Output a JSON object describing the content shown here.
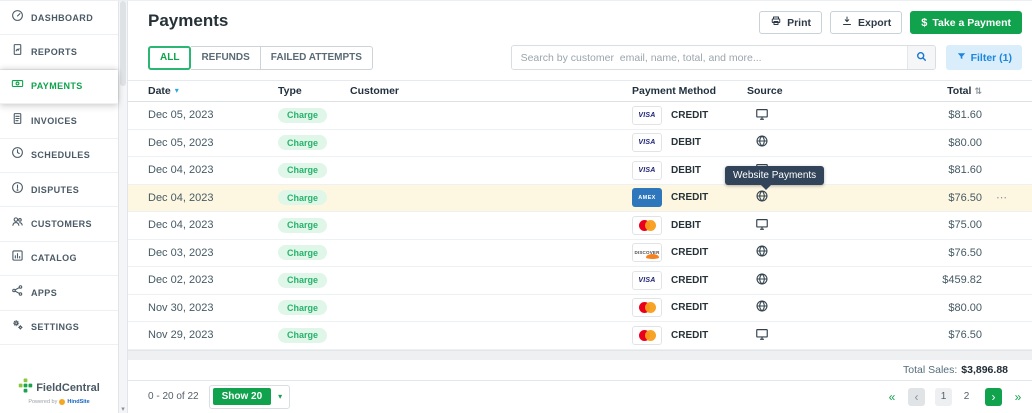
{
  "sidebar": {
    "items": [
      {
        "label": "DASHBOARD",
        "icon": "gauge-icon",
        "svg": "gauge",
        "active": false
      },
      {
        "label": "REPORTS",
        "icon": "report-icon",
        "svg": "report",
        "active": false
      },
      {
        "label": "PAYMENTS",
        "icon": "payments-icon",
        "svg": "payments",
        "active": true
      },
      {
        "label": "INVOICES",
        "icon": "invoice-icon",
        "svg": "invoice",
        "active": false
      },
      {
        "label": "SCHEDULES",
        "icon": "clock-icon",
        "svg": "clock",
        "active": false
      },
      {
        "label": "DISPUTES",
        "icon": "dispute-icon",
        "svg": "dispute",
        "active": false
      },
      {
        "label": "CUSTOMERS",
        "icon": "customers-icon",
        "svg": "customers",
        "active": false
      },
      {
        "label": "CATALOG",
        "icon": "catalog-icon",
        "svg": "catalog",
        "active": false
      },
      {
        "label": "APPS",
        "icon": "apps-icon",
        "svg": "apps",
        "active": false
      },
      {
        "label": "SETTINGS",
        "icon": "settings-icon",
        "svg": "settings",
        "active": false
      }
    ],
    "logo": {
      "name": "FieldCentral",
      "powered": "Powered by",
      "brand": "HindSite"
    }
  },
  "header": {
    "title": "Payments",
    "print_label": "Print",
    "export_label": "Export",
    "take_payment_label": "Take a Payment",
    "dollar_icon": "$"
  },
  "tabs": [
    {
      "label": "ALL",
      "active": true
    },
    {
      "label": "REFUNDS",
      "active": false
    },
    {
      "label": "FAILED ATTEMPTS",
      "active": false
    }
  ],
  "search": {
    "placeholder": "Search by customer  email, name, total, and more..."
  },
  "filter": {
    "label": "Filter (1)"
  },
  "table": {
    "columns": [
      "Date",
      "Type",
      "Customer",
      "Payment Method",
      "Source",
      "Total"
    ],
    "rows": [
      {
        "date": "Dec 05, 2023",
        "type": "Charge",
        "customer": "",
        "card": "visa",
        "method": "CREDIT",
        "source": "desktop",
        "total": "$81.60"
      },
      {
        "date": "Dec 05, 2023",
        "type": "Charge",
        "customer": "",
        "card": "visa",
        "method": "DEBIT",
        "source": "globe",
        "total": "$80.00"
      },
      {
        "date": "Dec 04, 2023",
        "type": "Charge",
        "customer": "",
        "card": "visa",
        "method": "DEBIT",
        "source": "desktop",
        "total": "$81.60"
      },
      {
        "date": "Dec 04, 2023",
        "type": "Charge",
        "customer": "",
        "card": "amex",
        "method": "CREDIT",
        "source": "globe",
        "total": "$76.50",
        "highlighted": true,
        "tooltip": "Website Payments",
        "menu": true
      },
      {
        "date": "Dec 04, 2023",
        "type": "Charge",
        "customer": "",
        "card": "mastercard",
        "method": "DEBIT",
        "source": "desktop",
        "total": "$75.00"
      },
      {
        "date": "Dec 03, 2023",
        "type": "Charge",
        "customer": "",
        "card": "discover",
        "method": "CREDIT",
        "source": "globe",
        "total": "$76.50"
      },
      {
        "date": "Dec 02, 2023",
        "type": "Charge",
        "customer": "",
        "card": "visa",
        "method": "CREDIT",
        "source": "globe",
        "total": "$459.82"
      },
      {
        "date": "Nov 30, 2023",
        "type": "Charge",
        "customer": "",
        "card": "mastercard",
        "method": "CREDIT",
        "source": "globe",
        "total": "$80.00"
      },
      {
        "date": "Nov 29, 2023",
        "type": "Charge",
        "customer": "",
        "card": "mastercard",
        "method": "CREDIT",
        "source": "desktop",
        "total": "$76.50"
      }
    ]
  },
  "summary": {
    "label": "Total Sales:",
    "value": "$3,896.88"
  },
  "pagination": {
    "range": "0 - 20 of 22",
    "show_label": "Show 20",
    "pages": [
      "1",
      "2"
    ],
    "current_page": "1"
  },
  "colors": {
    "accent_green": "#10A24C",
    "badge_bg": "#DFF6E9",
    "badge_text": "#27B36B",
    "highlight_row": "#FDF7E2",
    "tooltip_bg": "#31445A",
    "filter_bg": "#D9EDFB",
    "filter_text": "#1C87DC",
    "search_icon_blue": "#1976D2",
    "sort_arrow_blue": "#2BA9E0"
  }
}
